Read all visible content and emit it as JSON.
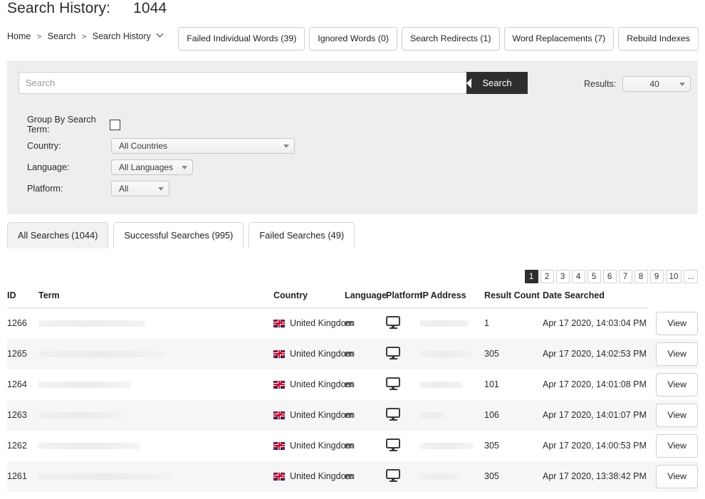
{
  "header": {
    "title_label": "Search History:",
    "title_count": "1044",
    "breadcrumb": [
      {
        "label": "Home"
      },
      {
        "label": "Search"
      },
      {
        "label": "Search History"
      }
    ],
    "breadcrumb_separator": ">",
    "actions": [
      {
        "name": "failed-individual-words",
        "label": "Failed Individual Words (39)"
      },
      {
        "name": "ignored-words",
        "label": "Ignored Words (0)"
      },
      {
        "name": "search-redirects",
        "label": "Search Redirects (1)"
      },
      {
        "name": "word-replacements",
        "label": "Word Replacements (7)"
      },
      {
        "name": "rebuild-indexes",
        "label": "Rebuild Indexes"
      }
    ]
  },
  "filters": {
    "search_value": "",
    "search_placeholder": "Search",
    "search_button_label": "Search",
    "results_label": "Results:",
    "results_value": "40",
    "group_by_label": "Group By Search Term:",
    "group_by_checked": false,
    "country_label": "Country:",
    "country_value": "All Countries",
    "language_label": "Language:",
    "language_value": "All Languages",
    "platform_label": "Platform:",
    "platform_value": "All"
  },
  "tabs": [
    {
      "name": "tab-all-searches",
      "label": "All Searches (1044)",
      "active": true
    },
    {
      "name": "tab-successful-searches",
      "label": "Successful Searches (995)",
      "active": false
    },
    {
      "name": "tab-failed-searches",
      "label": "Failed Searches (49)",
      "active": false
    }
  ],
  "pagination": {
    "current": "1",
    "pages": [
      "1",
      "2",
      "3",
      "4",
      "5",
      "6",
      "7",
      "8",
      "9",
      "10",
      "..."
    ]
  },
  "table": {
    "columns": {
      "id": "ID",
      "term": "Term",
      "country": "Country",
      "language": "Language",
      "platform": "Platform",
      "ip": "IP Address",
      "result_count": "Result Count",
      "date": "Date Searched",
      "action": ""
    },
    "row_action_label": "View",
    "rows": [
      {
        "id": "1266",
        "term": "",
        "country": "United Kingdom",
        "language": "en",
        "platform_icon": "desktop-monitor-icon",
        "ip": "",
        "result_count": "1",
        "date": "Apr 17 2020, 14:03:04 PM"
      },
      {
        "id": "1265",
        "term": "",
        "country": "United Kingdom",
        "language": "en",
        "platform_icon": "desktop-monitor-icon",
        "ip": "",
        "result_count": "305",
        "date": "Apr 17 2020, 14:02:53 PM"
      },
      {
        "id": "1264",
        "term": "",
        "country": "United Kingdom",
        "language": "en",
        "platform_icon": "desktop-monitor-icon",
        "ip": "",
        "result_count": "101",
        "date": "Apr 17 2020, 14:01:08 PM"
      },
      {
        "id": "1263",
        "term": "",
        "country": "United Kingdom",
        "language": "en",
        "platform_icon": "desktop-monitor-icon",
        "ip": "",
        "result_count": "106",
        "date": "Apr 17 2020, 14:01:07 PM"
      },
      {
        "id": "1262",
        "term": "",
        "country": "United Kingdom",
        "language": "en",
        "platform_icon": "desktop-monitor-icon",
        "ip": "",
        "result_count": "305",
        "date": "Apr 17 2020, 14:00:53 PM"
      },
      {
        "id": "1261",
        "term": "",
        "country": "United Kingdom",
        "language": "en",
        "platform_icon": "desktop-monitor-icon",
        "ip": "",
        "result_count": "305",
        "date": "Apr 17 2020, 13:38:42 PM"
      }
    ]
  },
  "colors": {
    "panel_bg": "#eeeeee",
    "accent_dark": "#2e2e2e",
    "stripe": "#f6f6f6",
    "border": "#d6d6d6"
  }
}
